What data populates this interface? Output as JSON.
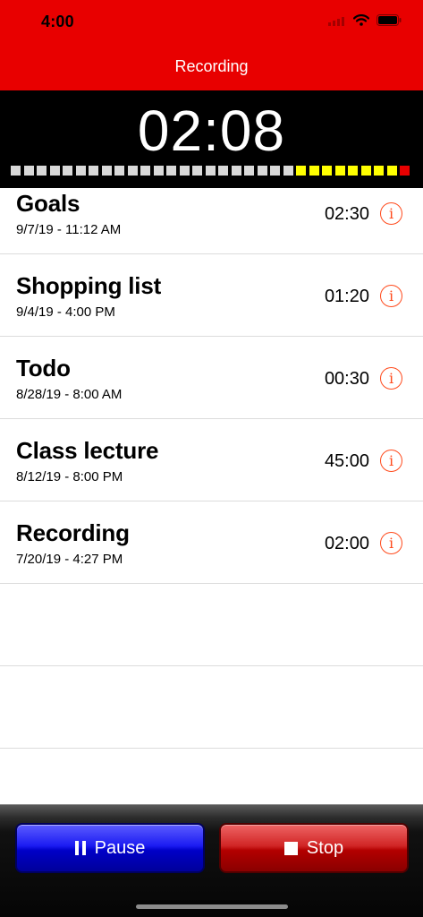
{
  "status_bar": {
    "time": "4:00",
    "icons": [
      "cellular-signal-icon",
      "wifi-icon",
      "battery-icon"
    ]
  },
  "nav": {
    "title": "Recording"
  },
  "timer": {
    "elapsed": "02:08",
    "level_meter": {
      "colors": [
        "#d9d9d9",
        "#d9d9d9",
        "#d9d9d9",
        "#d9d9d9",
        "#d9d9d9",
        "#d9d9d9",
        "#d9d9d9",
        "#d9d9d9",
        "#d9d9d9",
        "#d9d9d9",
        "#d9d9d9",
        "#d9d9d9",
        "#d9d9d9",
        "#d9d9d9",
        "#d9d9d9",
        "#d9d9d9",
        "#d9d9d9",
        "#d9d9d9",
        "#d9d9d9",
        "#d9d9d9",
        "#d9d9d9",
        "#d9d9d9",
        "#ffff00",
        "#ffff00",
        "#ffff00",
        "#ffff00",
        "#ffff00",
        "#ffff00",
        "#ffff00",
        "#ffff00",
        "#e80000"
      ]
    }
  },
  "recordings": [
    {
      "title": "Goals",
      "date": "9/7/19 - 11:12 AM",
      "duration": "02:30"
    },
    {
      "title": "Shopping list",
      "date": "9/4/19 - 4:00 PM",
      "duration": "01:20"
    },
    {
      "title": "Todo",
      "date": "8/28/19 - 8:00 AM",
      "duration": "00:30"
    },
    {
      "title": "Class lecture",
      "date": "8/12/19 - 8:00 PM",
      "duration": "45:00"
    },
    {
      "title": "Recording",
      "date": "7/20/19 - 4:27 PM",
      "duration": "02:00"
    }
  ],
  "info_icon_glyph": "i",
  "controls": {
    "pause_label": "Pause",
    "stop_label": "Stop"
  },
  "colors": {
    "header": "#e80000",
    "accent": "#ff4a1c",
    "pause_button": "#1c1cf2",
    "stop_button": "#d12626"
  }
}
